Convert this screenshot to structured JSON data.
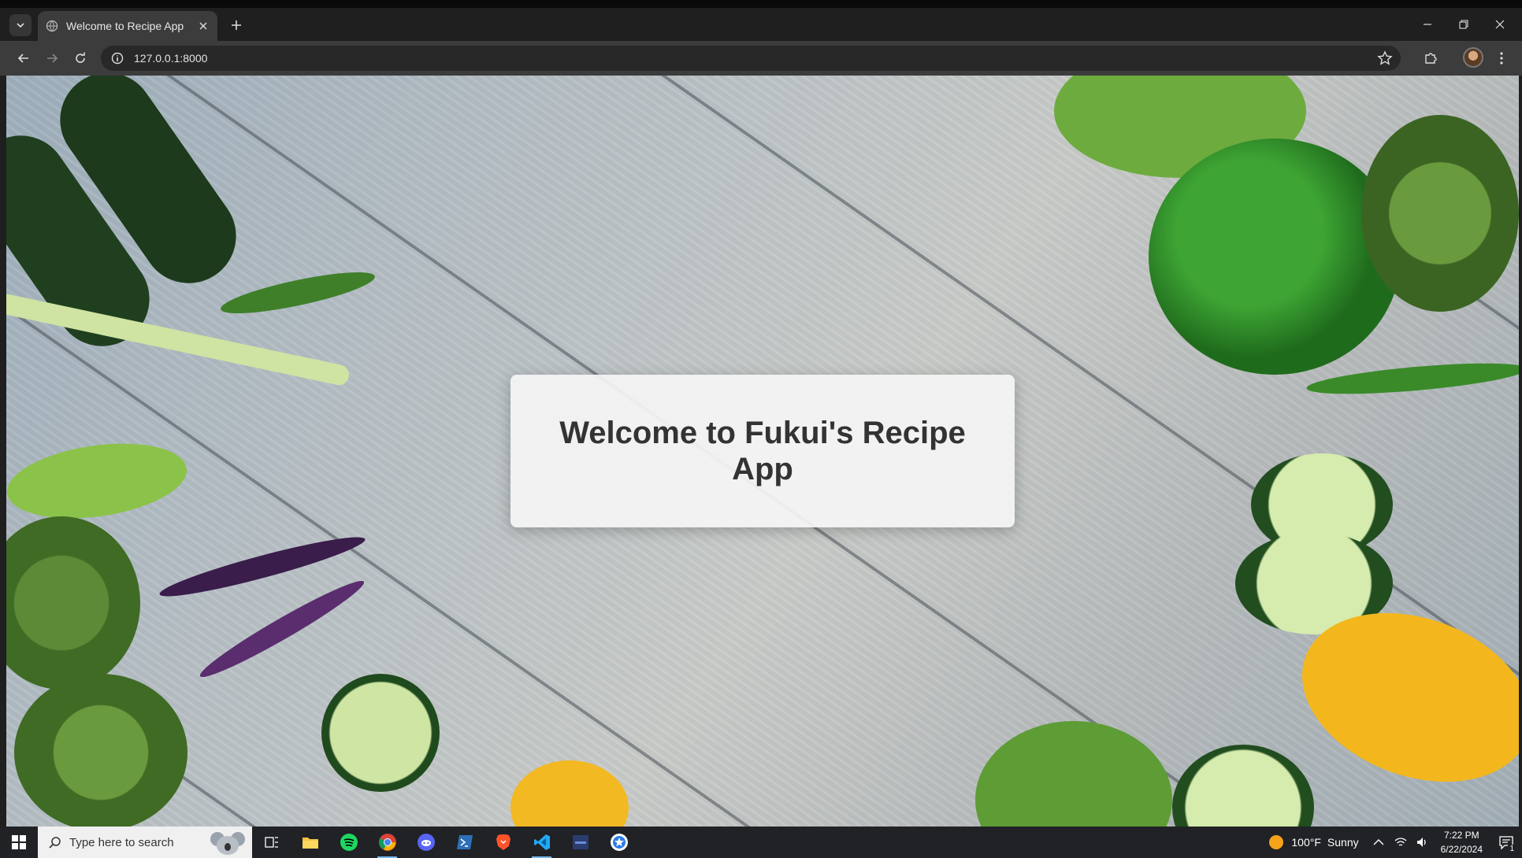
{
  "browser": {
    "tab_title": "Welcome to Recipe App",
    "url": "127.0.0.1:8000"
  },
  "page": {
    "heading": "Welcome to Fukui's Recipe App"
  },
  "taskbar": {
    "search_placeholder": "Type here to search",
    "apps": [
      "task-view",
      "file-explorer",
      "spotify",
      "chrome",
      "discord",
      "powershell",
      "brave",
      "vscode",
      "terminal-app",
      "settings-app"
    ],
    "weather_temp": "100°F",
    "weather_desc": "Sunny",
    "time": "7:22 PM",
    "date": "6/22/2024",
    "notification_count": "1"
  },
  "colors": {
    "chrome_dark": "#1f1f1f",
    "toolbar": "#3c3c3c",
    "taskbar": "#202226",
    "card_bg": "#f5f5f5",
    "heading_text": "#333333"
  }
}
